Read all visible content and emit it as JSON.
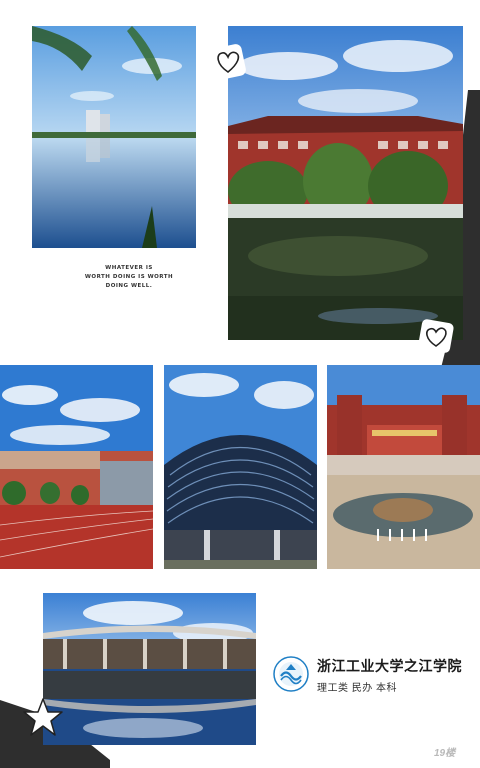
{
  "quote": {
    "line1": "WHATEVER IS",
    "line2": "WORTH DOING IS WORTH",
    "line3": "DOING WELL."
  },
  "school": {
    "name": "浙江工业大学之江学院",
    "subtitle": "理工类 民办 本科"
  },
  "watermark": "19楼",
  "colors": {
    "sky": "#3f86d6",
    "building_red": "#a0352c",
    "track_red": "#b4342a",
    "tape_dark": "#2e2e2e",
    "logo_blue": "#1f7fc5"
  },
  "icons": [
    "heart-icon",
    "heart-icon",
    "star-icon",
    "school-logo-icon"
  ]
}
